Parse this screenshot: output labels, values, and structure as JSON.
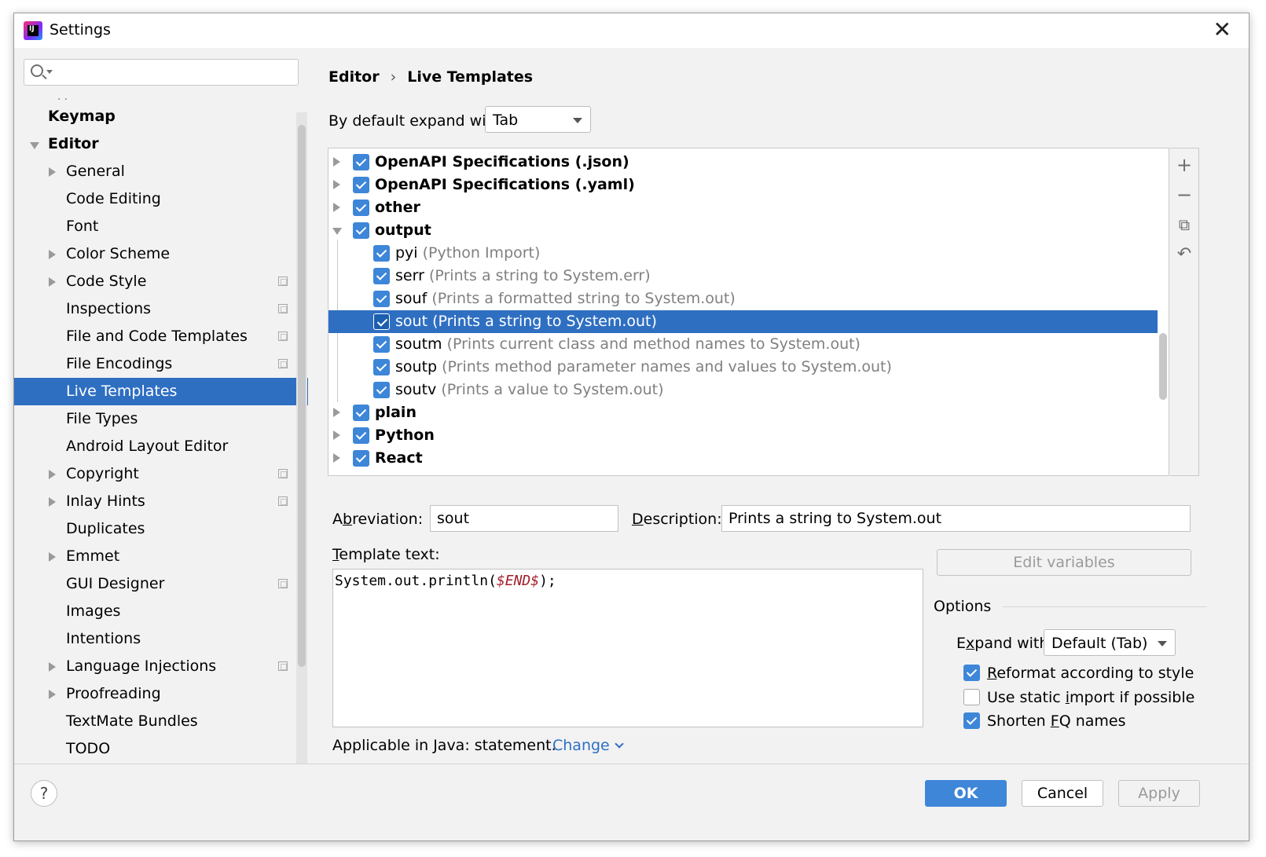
{
  "window": {
    "title": "Settings",
    "app_icon": "intellij-icon"
  },
  "sidebar": {
    "search_placeholder": "",
    "items": [
      {
        "label": "Keymap",
        "level": 0,
        "arrow": "none"
      },
      {
        "label": "Editor",
        "level": 0,
        "arrow": "down"
      },
      {
        "label": "General",
        "level": 1,
        "arrow": "right"
      },
      {
        "label": "Code Editing",
        "level": 1,
        "arrow": "none"
      },
      {
        "label": "Font",
        "level": 1,
        "arrow": "none"
      },
      {
        "label": "Color Scheme",
        "level": 1,
        "arrow": "right"
      },
      {
        "label": "Code Style",
        "level": 1,
        "arrow": "right",
        "project": true
      },
      {
        "label": "Inspections",
        "level": 1,
        "arrow": "none",
        "project": true
      },
      {
        "label": "File and Code Templates",
        "level": 1,
        "arrow": "none",
        "project": true
      },
      {
        "label": "File Encodings",
        "level": 1,
        "arrow": "none",
        "project": true
      },
      {
        "label": "Live Templates",
        "level": 1,
        "arrow": "none",
        "selected": true
      },
      {
        "label": "File Types",
        "level": 1,
        "arrow": "none"
      },
      {
        "label": "Android Layout Editor",
        "level": 1,
        "arrow": "none"
      },
      {
        "label": "Copyright",
        "level": 1,
        "arrow": "right",
        "project": true
      },
      {
        "label": "Inlay Hints",
        "level": 1,
        "arrow": "right",
        "project": true
      },
      {
        "label": "Duplicates",
        "level": 1,
        "arrow": "none"
      },
      {
        "label": "Emmet",
        "level": 1,
        "arrow": "right"
      },
      {
        "label": "GUI Designer",
        "level": 1,
        "arrow": "none",
        "project": true
      },
      {
        "label": "Images",
        "level": 1,
        "arrow": "none"
      },
      {
        "label": "Intentions",
        "level": 1,
        "arrow": "none"
      },
      {
        "label": "Language Injections",
        "level": 1,
        "arrow": "right",
        "project": true
      },
      {
        "label": "Proofreading",
        "level": 1,
        "arrow": "right"
      },
      {
        "label": "TextMate Bundles",
        "level": 1,
        "arrow": "none"
      },
      {
        "label": "TODO",
        "level": 1,
        "arrow": "none"
      }
    ]
  },
  "breadcrumb": {
    "parent": "Editor",
    "separator": "›",
    "current": "Live Templates"
  },
  "expand": {
    "label": "By default expand with",
    "value": "Tab"
  },
  "templates": [
    {
      "type": "group",
      "arrow": "right",
      "name": "OpenAPI Specifications (.json)",
      "checked": true
    },
    {
      "type": "group",
      "arrow": "right",
      "name": "OpenAPI Specifications (.yaml)",
      "checked": true
    },
    {
      "type": "group",
      "arrow": "right",
      "name": "other",
      "checked": true
    },
    {
      "type": "group",
      "arrow": "down",
      "name": "output",
      "checked": true
    },
    {
      "type": "child",
      "name": "pyi",
      "desc": "(Python Import)",
      "checked": true
    },
    {
      "type": "child",
      "name": "serr",
      "desc": "(Prints a string to System.err)",
      "checked": true
    },
    {
      "type": "child",
      "name": "souf",
      "desc": "(Prints a formatted string to System.out)",
      "checked": true
    },
    {
      "type": "child",
      "name": "sout",
      "desc": "(Prints a string to System.out)",
      "checked": true,
      "selected": true
    },
    {
      "type": "child",
      "name": "soutm",
      "desc": "(Prints current class and method names to System.out)",
      "checked": true
    },
    {
      "type": "child",
      "name": "soutp",
      "desc": "(Prints method parameter names and values to System.out)",
      "checked": true
    },
    {
      "type": "child",
      "name": "soutv",
      "desc": "(Prints a value to System.out)",
      "checked": true
    },
    {
      "type": "group",
      "arrow": "right",
      "name": "plain",
      "checked": true
    },
    {
      "type": "group",
      "arrow": "right",
      "name": "Python",
      "checked": true
    },
    {
      "type": "group",
      "arrow": "right",
      "name": "React",
      "checked": true
    }
  ],
  "toolbar": {
    "add": "+",
    "remove": "−",
    "copy": "⧉",
    "revert": "↶"
  },
  "editor": {
    "abbreviation_label_pre": "Ab",
    "abbreviation_label_ul": "b",
    "abbreviation_label_post": "reviation:",
    "abbreviation": "sout",
    "description_label_ul": "D",
    "description_label_post": "escription:",
    "description": "Prints a string to System.out",
    "template_label_ul": "T",
    "template_label_post": "emplate text:",
    "template_code_pre": "System.out.println(",
    "template_code_var": "$END$",
    "template_code_post": ");",
    "edit_variables": "Edit variables",
    "applicable": "Applicable in Java: statement.",
    "change": "Change"
  },
  "options": {
    "title": "Options",
    "expand_label_pre": "E",
    "expand_label_ul": "x",
    "expand_label_post": "pand with",
    "expand_value": "Default (Tab)",
    "reformat_ul": "R",
    "reformat_post": "eformat according to style",
    "reformat_checked": true,
    "static_import_pre": "Use static ",
    "static_import_ul": "i",
    "static_import_post": "mport if possible",
    "static_import_checked": false,
    "shorten_pre": "Shorten ",
    "shorten_ul": "F",
    "shorten_post": "Q names",
    "shorten_checked": true
  },
  "footer": {
    "help": "?",
    "ok": "OK",
    "cancel": "Cancel",
    "apply": "Apply"
  },
  "colors": {
    "selection": "#2f6fc2",
    "checkbox": "#3d86d8",
    "link": "#2e6fc5",
    "template_var": "#a0202a"
  }
}
